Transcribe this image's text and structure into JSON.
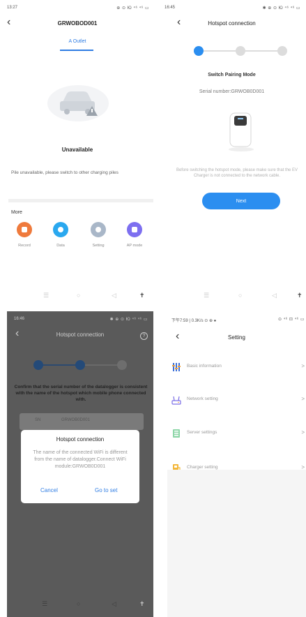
{
  "outlet_screen": {
    "status_time": "13:27",
    "status_icons": "⊕ ⊙ Ю ⁴⁶ ⁴⁶ ▭",
    "title": "GRWOBOD001",
    "tab_label": "A Outlet",
    "state": "Unavailable",
    "info": "Pile unavailable, please switch to other charging piles",
    "more_label": "More",
    "functions": [
      {
        "label": "Record",
        "color": "#ef7a3c"
      },
      {
        "label": "Data",
        "color": "#2aa8ef"
      },
      {
        "label": "Setting",
        "color": "#a9b7c8"
      },
      {
        "label": "AP mode",
        "color": "#7d6ff0"
      }
    ]
  },
  "pairing_screen": {
    "status_time": "16:45",
    "status_icons": "✱ ⊕ ⊙ Ю ⁴⁶ ⁴⁶ ▭",
    "title": "Hotspot connection",
    "heading": "Switch Pairing Mode",
    "serial": "Serial number:GRWOB0D001",
    "hint": "Before switching the hotspot mode, please make sure that the EV Charger is not connected to the network cable.",
    "next_label": "Next"
  },
  "dialog_screen": {
    "status_time": "16:46",
    "status_icons": "✱ ⊕ ⊙ Ю ⁴⁶ ⁴⁶ ▭",
    "title": "Hotspot connection",
    "help": "?",
    "confirm_text": "Confirm that the serial number of the datalogger is consistent with the name of the hotspot which mobile phone connected with.",
    "card_left": "SN",
    "card_right": "GRWOB0D001",
    "dialog": {
      "title": "Hotspot connection",
      "message": "The name of the connected WiFi is different from the name of datalogger.Connect WiFi module:GRWOB0D001",
      "cancel": "Cancel",
      "confirm": "Go to set"
    }
  },
  "setting_screen": {
    "status_left": "下午7:59 | 0.3K/s ⊙ ⊕ ●",
    "status_right": "⊙ ⁴⁶ ⊡ ⁴⁶ ▭",
    "title": "Setting",
    "items": [
      {
        "label": "Basic information",
        "icon": "sliders-icon"
      },
      {
        "label": "Network setting",
        "icon": "router-icon"
      },
      {
        "label": "Server settings",
        "icon": "server-icon"
      },
      {
        "label": "Charger setting",
        "icon": "charger-icon"
      }
    ],
    "chevron": ">"
  }
}
